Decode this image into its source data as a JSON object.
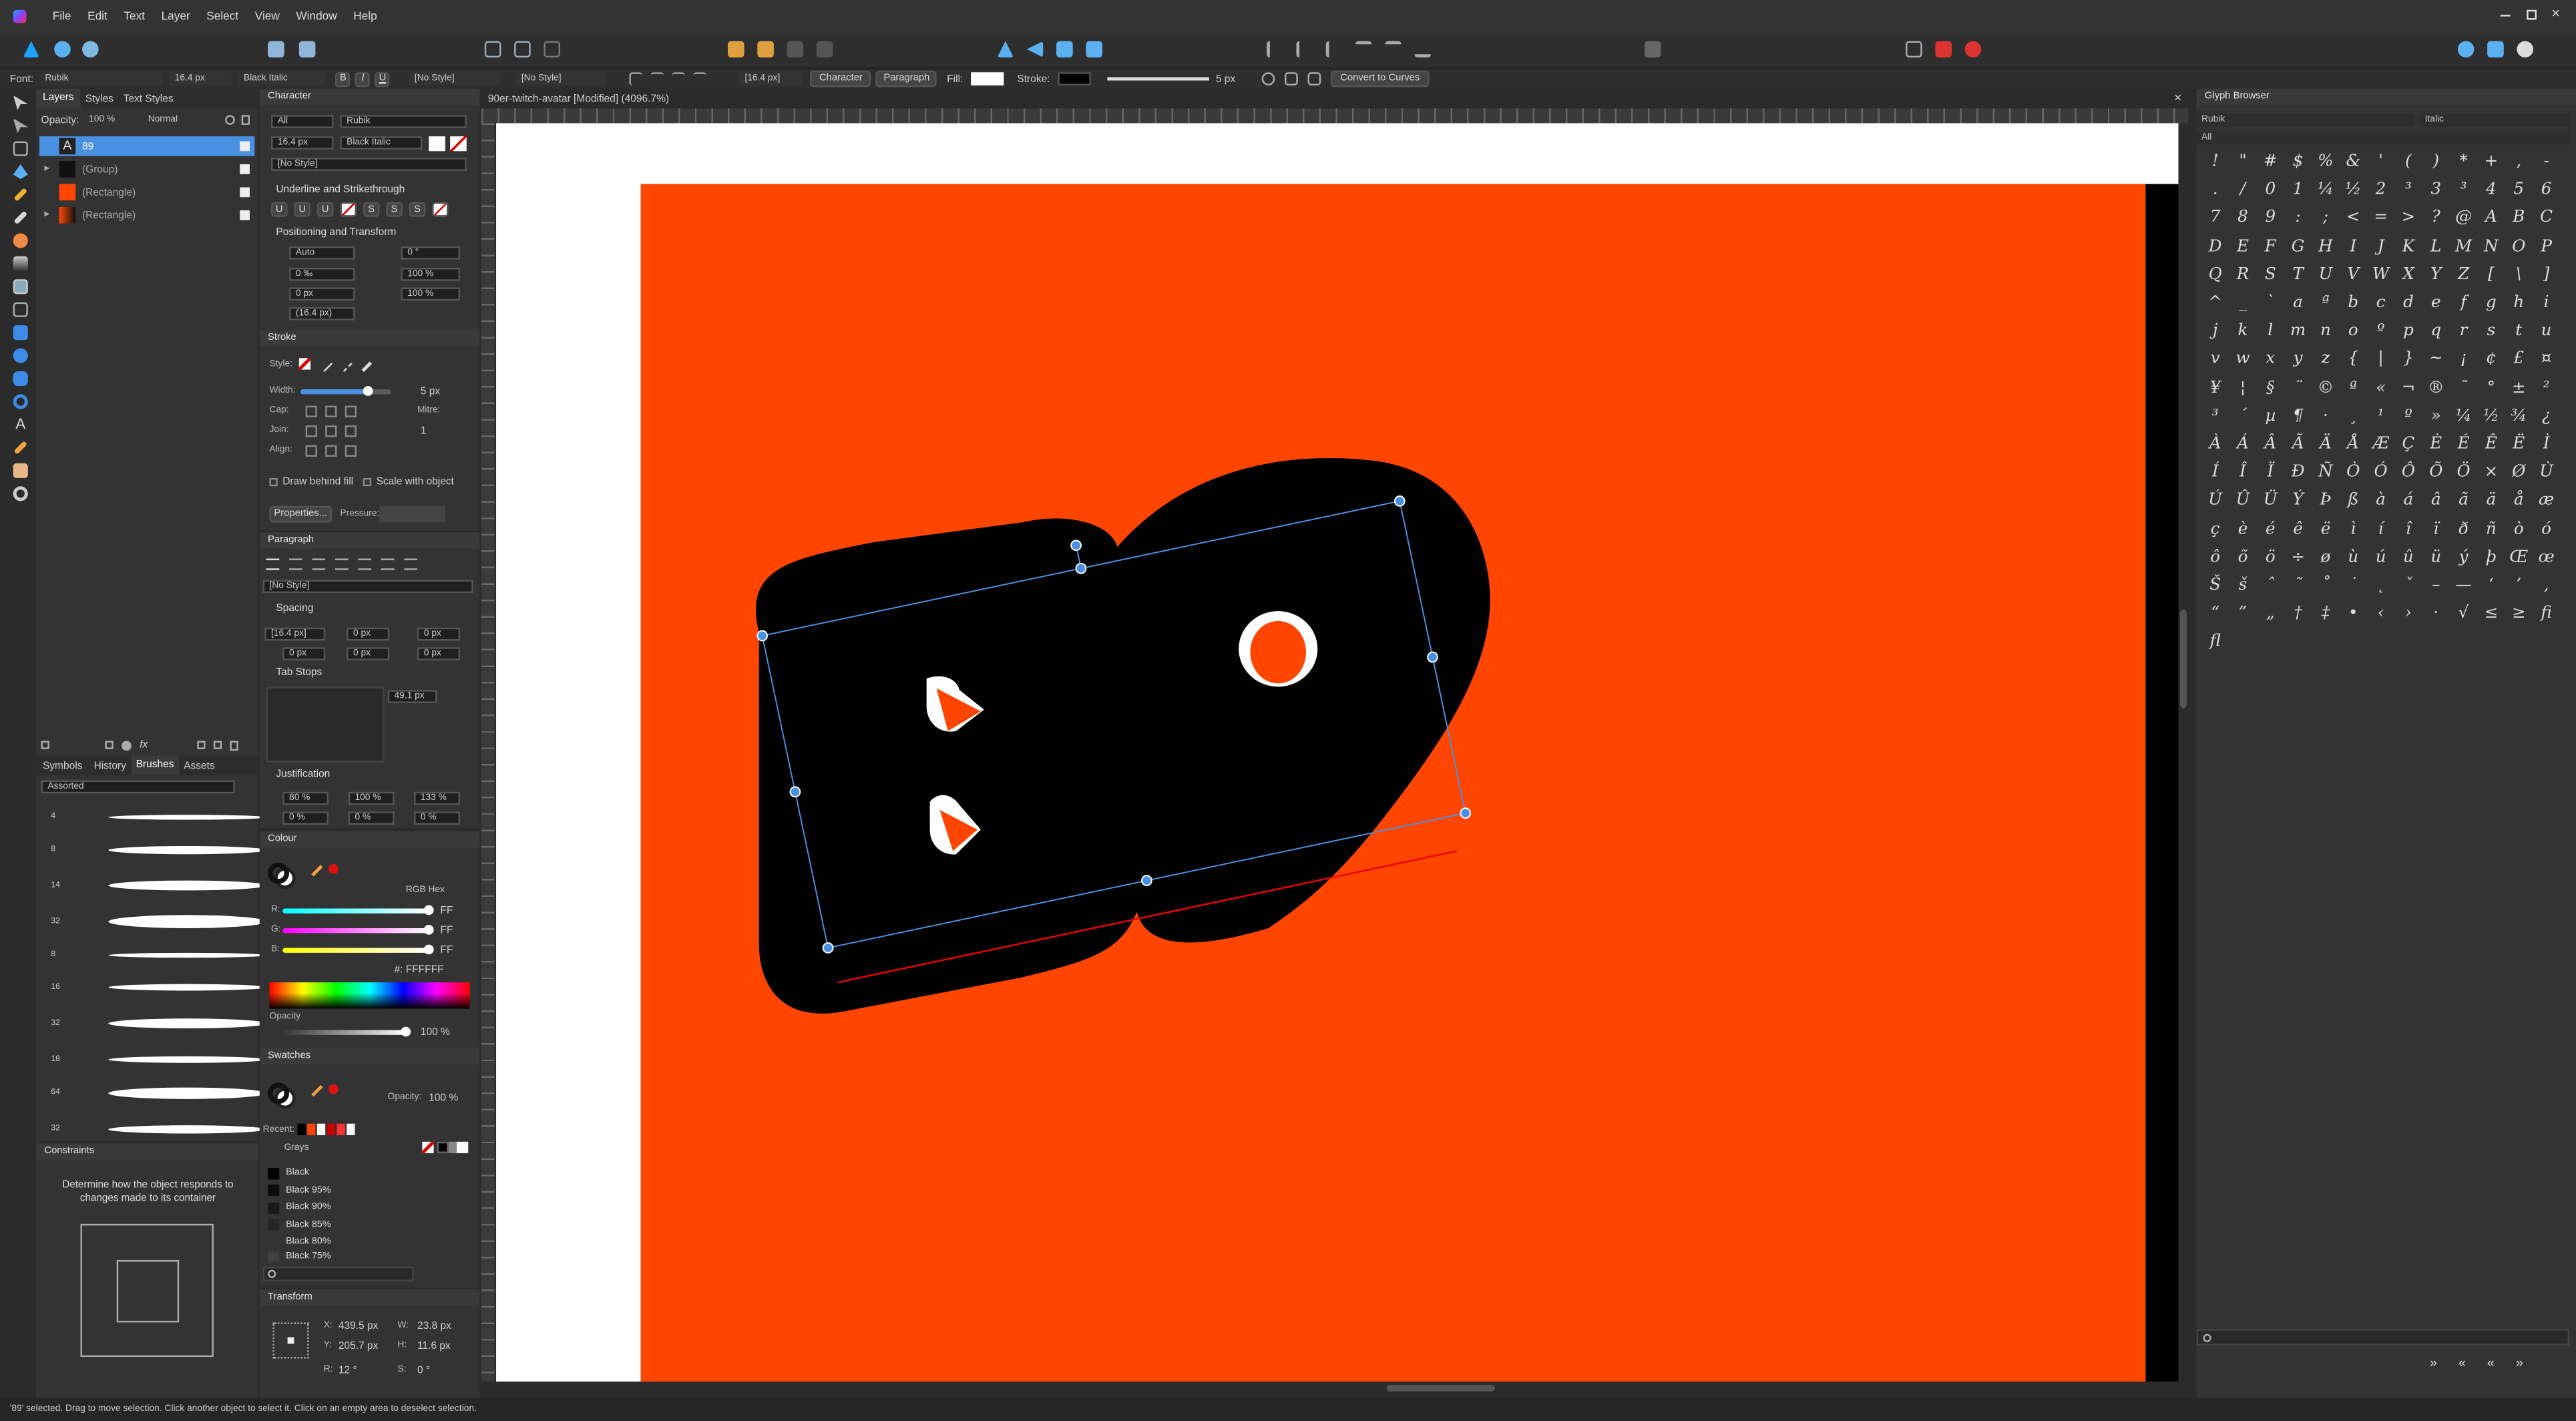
{
  "menu": [
    "File",
    "Edit",
    "Text",
    "Layer",
    "Select",
    "View",
    "Window",
    "Help"
  ],
  "context": {
    "font_label": "Font:",
    "font": "Rubik",
    "size": "16.4 px",
    "style": "Black Italic",
    "bold": "B",
    "italic": "I",
    "underline": "U",
    "para_style": "[No Style]",
    "char_style": "[No Style]",
    "leading": "[16.4 px]",
    "character_btn": "Character",
    "paragraph_btn": "Paragraph",
    "fill_label": "Fill:",
    "stroke_label": "Stroke:",
    "stroke_width": "5 px",
    "convert_btn": "Convert to Curves"
  },
  "layers": {
    "tabs": [
      "Layers",
      "Styles",
      "Text Styles"
    ],
    "opacity_label": "Opacity:",
    "opacity": "100 %",
    "blend": "Normal",
    "items": [
      {
        "name": "89",
        "selected": true
      },
      {
        "name": "(Group)"
      },
      {
        "name": "(Rectangle)"
      },
      {
        "name": "(Rectangle)"
      }
    ]
  },
  "brushes": {
    "tabs": [
      "Symbols",
      "History",
      "Brushes",
      "Assets"
    ],
    "category": "Assorted",
    "sizes": [
      "4",
      "8",
      "14",
      "32",
      "8",
      "16",
      "32",
      "18",
      "64",
      "32"
    ]
  },
  "constraints": {
    "title": "Constraints",
    "text": "Determine how the object responds to changes made to its container"
  },
  "character": {
    "title": "Character",
    "filter": "All",
    "font": "Rubik",
    "size": "16.4 px",
    "style": "Black Italic",
    "char_style": "[No Style]",
    "underline_title": "Underline and Strikethrough",
    "positioning_title": "Positioning and Transform",
    "kerning": "Auto",
    "tracking": "0 ‰",
    "baseline": "0 px",
    "leading": "(16.4 px)",
    "shear": "0 °",
    "hscale": "100 %",
    "vscale": "100 %"
  },
  "stroke": {
    "title": "Stroke",
    "style_label": "Style:",
    "width_label": "Width:",
    "width": "5 px",
    "cap_label": "Cap:",
    "join_label": "Join:",
    "align_label": "Align:",
    "mitre_label": "Mitre:",
    "mitre": "1",
    "draw_behind": "Draw behind fill",
    "scale_with": "Scale with object",
    "properties": "Properties...",
    "pressure": "Pressure:"
  },
  "paragraph": {
    "title": "Paragraph",
    "style": "[No Style]",
    "spacing_title": "Spacing",
    "leading": "[16.4 px]",
    "before": "0 px",
    "after": "0 px",
    "left": "0 px",
    "right": "0 px",
    "first": "0 px",
    "last": "0 px",
    "tabstops_title": "Tab Stops",
    "tab_width": "49.1 px",
    "justification_title": "Justification",
    "word_min": "80 %",
    "word_des": "100 %",
    "word_max": "133 %",
    "letter_min": "0 %",
    "letter_des": "0 %",
    "letter_max": "0 %"
  },
  "colour": {
    "title": "Colour",
    "model": "RGB Hex",
    "r_label": "R:",
    "g_label": "G:",
    "b_label": "B:",
    "r": "FF",
    "g": "FF",
    "b": "FF",
    "hex": "#: FFFFFF",
    "opacity_label": "Opacity",
    "opacity": "100 %"
  },
  "swatches": {
    "title": "Swatches",
    "opacity_label": "Opacity:",
    "opacity": "100 %",
    "recent_label": "Recent:",
    "palette": "Grays",
    "items": [
      "Black",
      "Black 95%",
      "Black 90%",
      "Black 85%",
      "Black 80%",
      "Black 75%"
    ]
  },
  "transform": {
    "title": "Transform",
    "x_label": "X:",
    "x": "439.5 px",
    "y_label": "Y:",
    "y": "205.7 px",
    "w_label": "W:",
    "w": "23.8 px",
    "h_label": "H:",
    "h": "11.6 px",
    "r_label": "R:",
    "r": "12 °",
    "s_label": "S:",
    "s": "0 °"
  },
  "document": {
    "title": "90er-twitch-avatar [Modified] (4096.7%)"
  },
  "glyph": {
    "title": "Glyph Browser",
    "font": "Rubik",
    "style": "Italic",
    "filter": "All",
    "chars": [
      "!",
      "\"",
      "#",
      "$",
      "%",
      "&",
      "'",
      "(",
      ")",
      "*",
      "+",
      ",",
      "-",
      ".",
      "/",
      "0",
      "1",
      "¼",
      "½",
      "2",
      "³",
      "3",
      "³",
      "4",
      "5",
      "6",
      "7",
      "8",
      "9",
      ":",
      ";",
      "<",
      "=",
      ">",
      "?",
      "@",
      "A",
      "B",
      "C",
      "D",
      "E",
      "F",
      "G",
      "H",
      "I",
      "J",
      "K",
      "L",
      "M",
      "N",
      "O",
      "P",
      "Q",
      "R",
      "S",
      "T",
      "U",
      "V",
      "W",
      "X",
      "Y",
      "Z",
      "[",
      "\\",
      "]",
      "^",
      "_",
      "`",
      "a",
      "ª",
      "b",
      "c",
      "d",
      "e",
      "f",
      "g",
      "h",
      "i",
      "j",
      "k",
      "l",
      "m",
      "n",
      "o",
      "º",
      "p",
      "q",
      "r",
      "s",
      "t",
      "u",
      "v",
      "w",
      "x",
      "y",
      "z",
      "{",
      "|",
      "}",
      "~",
      "¡",
      "¢",
      "£",
      "¤",
      "¥",
      "¦",
      "§",
      "¨",
      "©",
      "ª",
      "«",
      "¬",
      "®",
      "¯",
      "°",
      "±",
      "²",
      "³",
      "´",
      "µ",
      "¶",
      "·",
      "¸",
      "¹",
      "º",
      "»",
      "¼",
      "½",
      "¾",
      "¿",
      "À",
      "Á",
      "Â",
      "Ã",
      "Ä",
      "Å",
      "Æ",
      "Ç",
      "È",
      "É",
      "Ê",
      "Ë",
      "Ì",
      "Í",
      "Î",
      "Ï",
      "Ð",
      "Ñ",
      "Ò",
      "Ó",
      "Ô",
      "Õ",
      "Ö",
      "×",
      "Ø",
      "Ù",
      "Ú",
      "Û",
      "Ü",
      "Ý",
      "Þ",
      "ß",
      "à",
      "á",
      "â",
      "ã",
      "ä",
      "å",
      "æ",
      "ç",
      "è",
      "é",
      "ê",
      "ë",
      "ì",
      "í",
      "î",
      "ï",
      "ð",
      "ñ",
      "ò",
      "ó",
      "ô",
      "õ",
      "ö",
      "÷",
      "ø",
      "ù",
      "ú",
      "û",
      "ü",
      "ý",
      "þ",
      "Œ",
      "œ",
      "Š",
      "š",
      "ˆ",
      "˜",
      "˚",
      "˙",
      "˛",
      "ˇ",
      "–",
      "—",
      "‘",
      "’",
      "‚",
      "“",
      "”",
      "„",
      "†",
      "‡",
      "•",
      "‹",
      "›",
      "·",
      "√",
      "≤",
      "≥",
      "ﬁ",
      "ﬂ"
    ],
    "nav": [
      "»",
      "«",
      "«",
      "»"
    ]
  },
  "status": "'89' selected. Drag to move selection. Click another object to select it. Click on an empty area to deselect selection.",
  "colors": {
    "artboard": "#ff4500",
    "selection": "#4a90e2",
    "accent": "#4a90e2"
  }
}
